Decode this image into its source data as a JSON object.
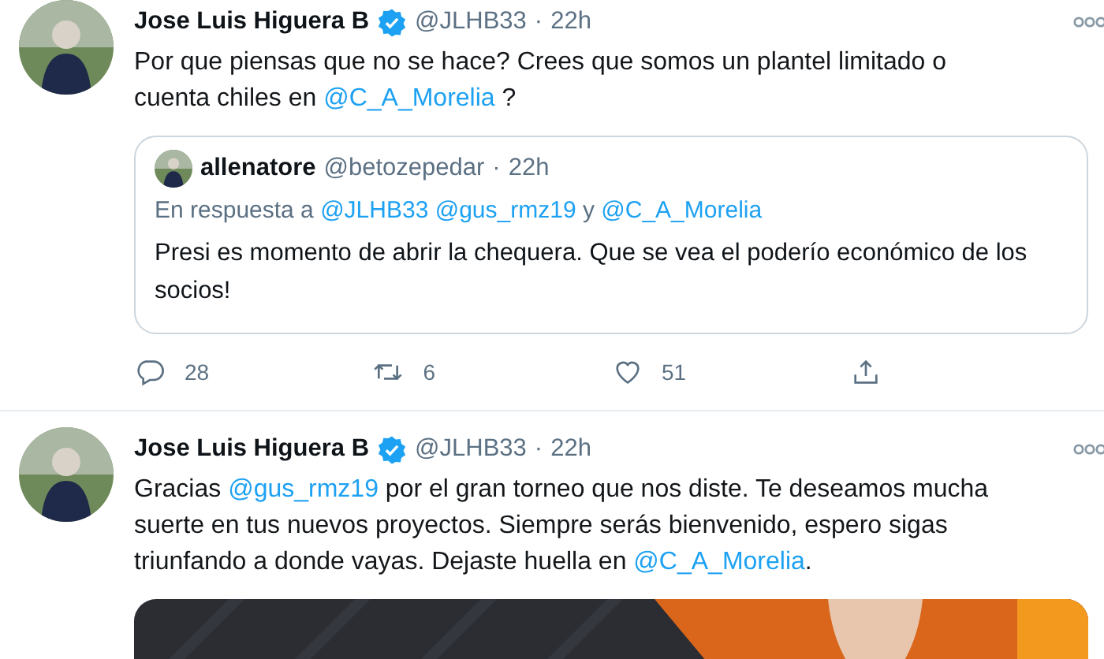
{
  "tweets": [
    {
      "author": {
        "name": "Jose Luis Higuera B",
        "verified": true,
        "handle": "@JLHB33",
        "separator": "·",
        "time": "22h"
      },
      "text": [
        {
          "kind": "text",
          "text": "Por que piensas que no se hace? Crees que somos un plantel limitado o cuenta chiles en "
        },
        {
          "kind": "mention",
          "text": "@C_A_Morelia"
        },
        {
          "kind": "text",
          "text": " ?"
        }
      ],
      "quote": {
        "author": {
          "name": "allenatore",
          "handle": "@betozepedar",
          "separator": "·",
          "time": "22h"
        },
        "reply_to": [
          {
            "kind": "text",
            "text": "En respuesta a "
          },
          {
            "kind": "mention",
            "text": "@JLHB33"
          },
          {
            "kind": "mention",
            "text": "@gus_rmz19"
          },
          {
            "kind": "text",
            "text": " y "
          },
          {
            "kind": "mention",
            "text": "@C_A_Morelia"
          }
        ],
        "text": "Presi es momento de abrir la chequera. Que se vea el poderío económico de los socios!"
      },
      "actions": {
        "replies": "28",
        "retweets": "6",
        "likes": "51"
      }
    },
    {
      "author": {
        "name": "Jose Luis Higuera B",
        "verified": true,
        "handle": "@JLHB33",
        "separator": "·",
        "time": "22h"
      },
      "text": [
        {
          "kind": "text",
          "text": "Gracias "
        },
        {
          "kind": "mention",
          "text": "@gus_rmz19"
        },
        {
          "kind": "text",
          "text": " por el gran torneo que nos diste. Te deseamos mucha suerte en tus nuevos proyectos. Siempre serás bienvenido, espero sigas triunfando a donde vayas. Dejaste huella en "
        },
        {
          "kind": "mention",
          "text": "@C_A_Morelia"
        },
        {
          "kind": "text",
          "text": "."
        }
      ]
    }
  ]
}
